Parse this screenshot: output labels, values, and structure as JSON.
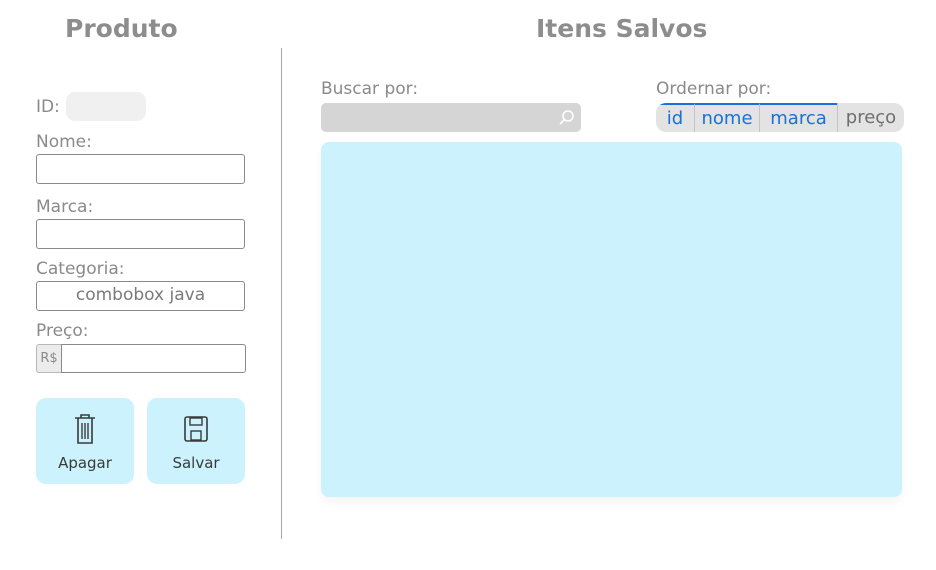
{
  "left_panel": {
    "title": "Produto",
    "id_label": "ID:",
    "nome_label": "Nome:",
    "marca_label": "Marca:",
    "categoria_label": "Categoria:",
    "categoria_value": "combobox java",
    "preco_label": "Preço:",
    "preco_prefix": "R$",
    "buttons": {
      "apagar": "Apagar",
      "salvar": "Salvar"
    }
  },
  "right_panel": {
    "title": "Itens Salvos",
    "search_label": "Buscar por:",
    "sort_label": "Ordernar por:",
    "sort_options": [
      {
        "label": "id",
        "selected": true
      },
      {
        "label": "nome",
        "selected": true
      },
      {
        "label": "marca",
        "selected": true
      },
      {
        "label": "preço",
        "selected": false
      }
    ]
  },
  "colors": {
    "accent": "#1a6fd8",
    "button_bg": "#ccf2fd",
    "list_bg": "#ccf2fd"
  },
  "icons": {
    "delete": "trash-icon",
    "save": "save-icon",
    "search": "search-icon"
  }
}
